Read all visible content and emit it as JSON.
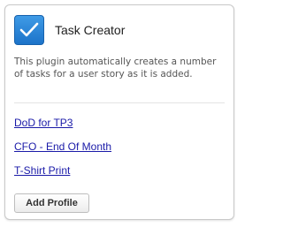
{
  "plugin": {
    "icon": "checkmark-icon",
    "title": "Task Creator",
    "description": "This plugin automatically creates a number of tasks for a user story as it is added."
  },
  "profiles": [
    {
      "label": "DoD for TP3"
    },
    {
      "label": "CFO - End Of Month"
    },
    {
      "label": "T-Shirt Print"
    }
  ],
  "actions": {
    "add_profile_label": "Add Profile"
  },
  "colors": {
    "icon_background": "#2a86d8",
    "link": "#1a1aa8"
  }
}
